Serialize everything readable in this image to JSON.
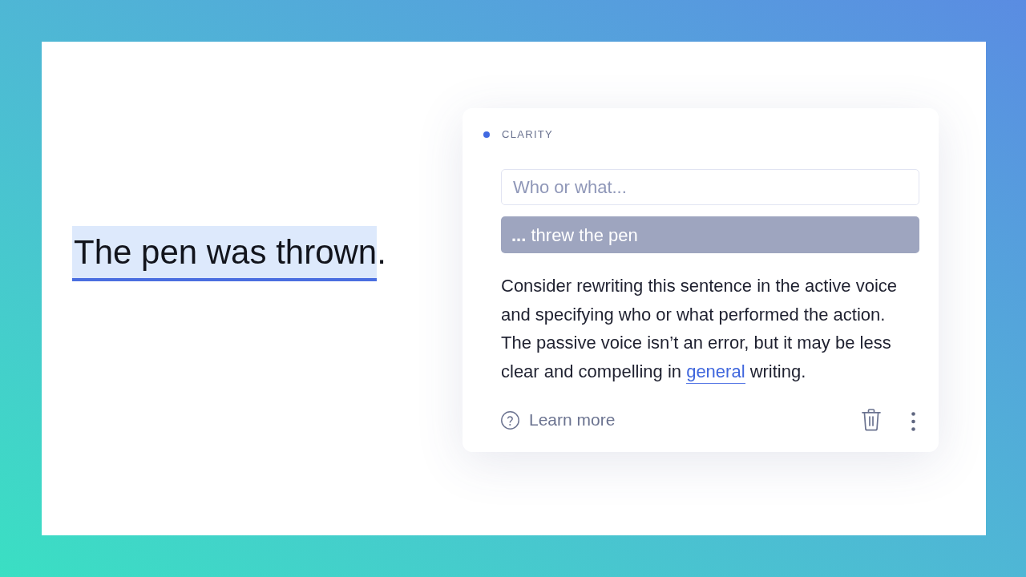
{
  "document": {
    "sentence": {
      "highlighted": "The pen was thrown",
      "after": "."
    }
  },
  "suggestion_card": {
    "category": "CLARITY",
    "input": {
      "placeholder": "Who or what..."
    },
    "suggestion": "**...** threw the pen",
    "explanation": [
      {
        "kind": "text",
        "text": "Consider rewriting this sentence in the active voice and specifying who or what performed the action. The passive voice isn’t an error, but it may be less clear and compelling in "
      },
      {
        "kind": "link",
        "text": "general"
      },
      {
        "kind": "text",
        "text": " writing."
      }
    ],
    "footer": {
      "learn_more": "Learn more"
    }
  }
}
